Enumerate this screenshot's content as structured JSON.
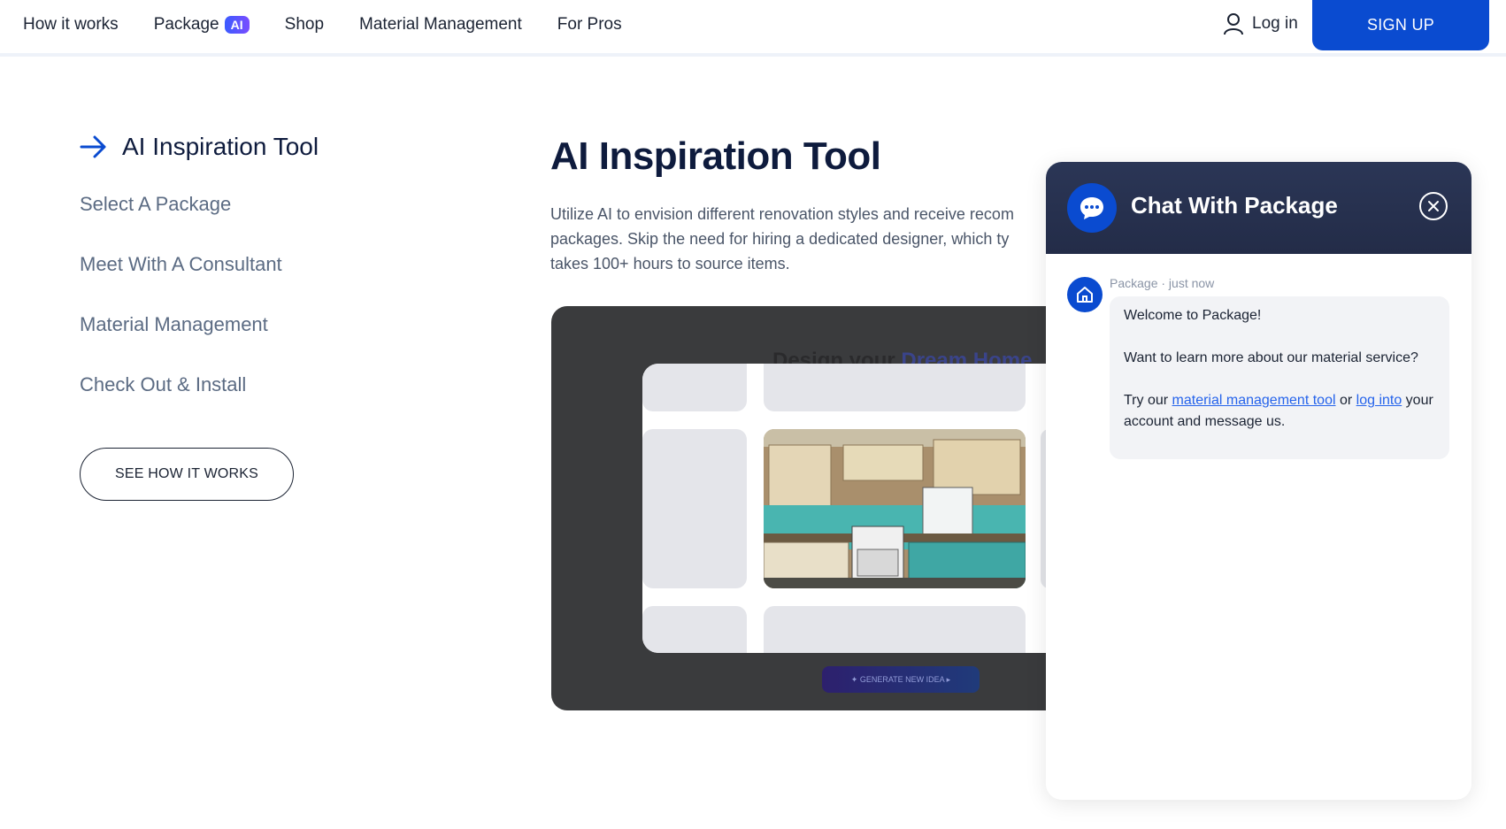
{
  "nav": {
    "items": [
      {
        "label": "How it works"
      },
      {
        "label": "Package",
        "badge": "AI"
      },
      {
        "label": "Shop"
      },
      {
        "label": "Material Management"
      },
      {
        "label": "For Pros"
      }
    ],
    "login_label": "Log in",
    "signup_label": "SIGN UP"
  },
  "steps": {
    "active": "AI Inspiration Tool",
    "items": [
      "Select A Package",
      "Meet With A Consultant",
      "Material Management",
      "Check Out & Install"
    ],
    "cta": "SEE HOW IT WORKS"
  },
  "main": {
    "title": "AI Inspiration Tool",
    "desc_lines": [
      "Utilize AI to envision different renovation styles and receive recom",
      "packages. Skip the need for hiring a dedicated designer, which ty",
      "takes 100+ hours to source items."
    ],
    "demo_title_a": "Design your ",
    "demo_title_b": "Dream Home",
    "gen_button": "✦ GENERATE NEW IDEA ▸"
  },
  "chat": {
    "title": "Chat With Package",
    "sender": "Package",
    "time": "just now",
    "meta": "Package · just now",
    "line1": "Welcome to Package!",
    "line2": "Want to learn more about our material service?",
    "try_prefix": "Try our ",
    "link1": "material management tool",
    "or": " or ",
    "link2": "log into",
    "suffix": " your account and message us."
  },
  "colors": {
    "brand": "#0a4bd0",
    "chat_header": "#2b3656",
    "text_dark": "#0e1b3d"
  }
}
